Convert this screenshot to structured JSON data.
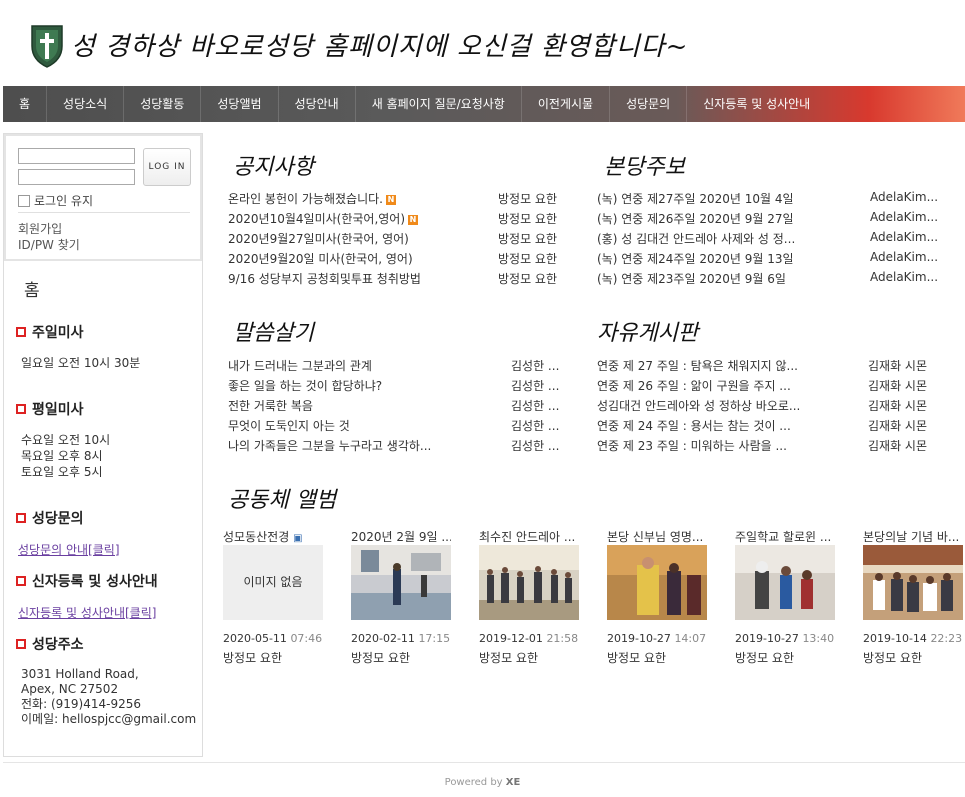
{
  "header": {
    "banner": "성 경하상 바오로성당 홈페이지에 오신걸 환영합니다~"
  },
  "nav": [
    "홈",
    "성당소식",
    "성당활동",
    "성당앨범",
    "성당안내",
    "새 홈페이지 질문/요청사항",
    "이전게시물",
    "성당문의",
    "신자등록 및 성사안내"
  ],
  "login": {
    "button": "LOG IN",
    "keep": "로그인 유지",
    "signup": "회원가입",
    "find": "ID/PW 찾기"
  },
  "sidebar": {
    "home": "홈",
    "sunday_title": "주일미사",
    "sunday_text": "일요일 오전 10시 30분",
    "weekday_title": "평일미사",
    "weekday_lines": [
      "수요일 오전 10시",
      "목요일 오후 8시",
      "토요일 오후 5시"
    ],
    "inquiry_title": "성당문의",
    "inquiry_link": "성당문의 안내[클릭]",
    "register_title": "신자등록 및 성사안내",
    "register_link": "신자등록 및 성사안내[클릭]",
    "address_title": "성당주소",
    "address_lines": [
      "3031 Holland Road,",
      "Apex, NC 27502",
      "전화: (919)414-9256",
      "이메일: hellospjcc@gmail.com"
    ]
  },
  "boards": {
    "notice": {
      "title": "공지사항",
      "rows": [
        {
          "text": "온라인 봉헌이 가능해졌습니다.",
          "new": true,
          "author": "방정모 요한"
        },
        {
          "text": "2020년10월4일미사(한국어,영어)",
          "new": true,
          "author": "방정모 요한"
        },
        {
          "text": "2020년9월27일미사(한국어, 영어)",
          "new": false,
          "author": "방정모 요한"
        },
        {
          "text": "2020년9월20일 미사(한국어, 영어)",
          "new": false,
          "author": "방정모 요한"
        },
        {
          "text": "9/16 성당부지 공청회및투표 청취방법",
          "new": false,
          "author": "방정모 요한"
        }
      ]
    },
    "bulletin": {
      "title": "본당주보",
      "rows": [
        {
          "text": "(녹) 연중 제27주일 2020년 10월 4일",
          "author": "AdelaKim..."
        },
        {
          "text": "(녹) 연중 제26주일 2020년 9월 27일",
          "author": "AdelaKim..."
        },
        {
          "text": "(홍) 성 김대건 안드레아 사제와 성 정...",
          "author": "AdelaKim..."
        },
        {
          "text": "(녹) 연중 제24주일 2020년 9월 13일",
          "author": "AdelaKim..."
        },
        {
          "text": "(녹) 연중 제23주일 2020년 9월 6일",
          "author": "AdelaKim..."
        }
      ]
    },
    "word": {
      "title": "말씀살기",
      "rows": [
        {
          "text": "내가 드러내는 그분과의 관계",
          "author": "김성한 ..."
        },
        {
          "text": "좋은 일을 하는 것이 합당하냐?",
          "author": "김성한 ..."
        },
        {
          "text": "전한 거룩한 복음",
          "author": "김성한 ..."
        },
        {
          "text": "무엇이 도둑인지 아는 것",
          "author": "김성한 ..."
        },
        {
          "text": "나의 가족들은 그분을 누구라고 생각하...",
          "author": "김성한 ..."
        }
      ]
    },
    "free": {
      "title": "자유게시판",
      "rows": [
        {
          "text": "연중 제 27 주일 : 탐욕은 채워지지 않...",
          "author": "김재화 시몬"
        },
        {
          "text": "연중 제 26 주일 : 앎이 구원을 주지 ...",
          "author": "김재화 시몬"
        },
        {
          "text": "성김대건 안드레아와 성 정하상 바오로...",
          "author": "김재화 시몬"
        },
        {
          "text": "연중 제 24 주일 : 용서는 참는 것이 ...",
          "author": "김재화 시몬"
        },
        {
          "text": "연중 제 23 주일 : 미워하는 사람을 ...",
          "author": "김재화 시몬"
        }
      ]
    }
  },
  "gallery": {
    "title": "공동체 앨범",
    "no_image": "이미지 없음",
    "items": [
      {
        "title": "성모동산전경",
        "date": "2020-05-11",
        "time": "07:46",
        "author": "방정모 요한"
      },
      {
        "title": "2020년 2월 9일 ...",
        "date": "2020-02-11",
        "time": "17:15",
        "author": "방정모 요한"
      },
      {
        "title": "최수진 안드레아 ...",
        "date": "2019-12-01",
        "time": "21:58",
        "author": "방정모 요한"
      },
      {
        "title": "본당 신부님 영명...",
        "date": "2019-10-27",
        "time": "14:07",
        "author": "방정모 요한"
      },
      {
        "title": "주일학교 할로윈 ...",
        "date": "2019-10-27",
        "time": "13:40",
        "author": "방정모 요한"
      },
      {
        "title": "본당의날 기념 바...",
        "date": "2019-10-14",
        "time": "22:23",
        "author": "방정모 요한"
      }
    ]
  },
  "footer": {
    "powered": "Powered by",
    "brand": "XE"
  }
}
